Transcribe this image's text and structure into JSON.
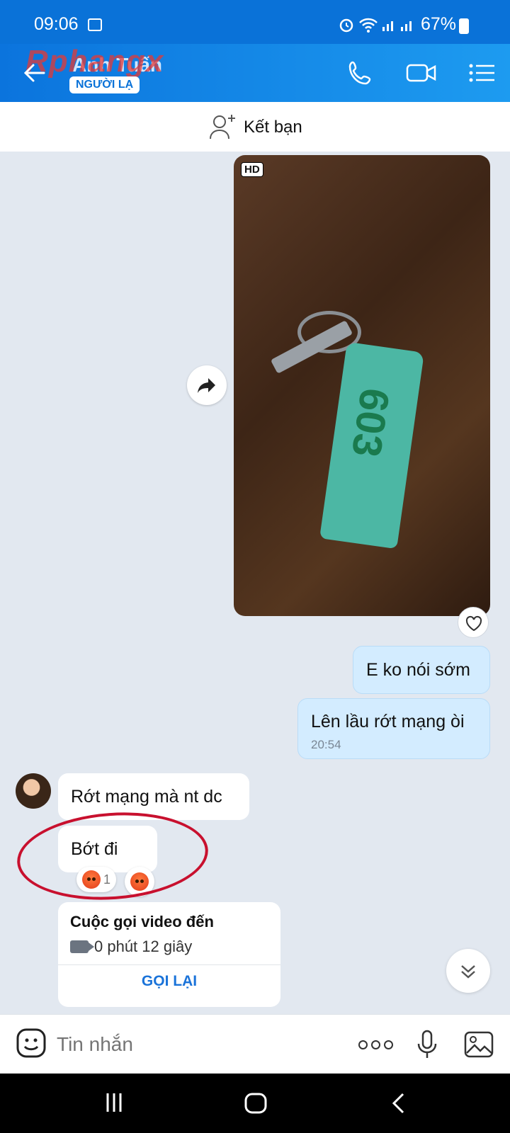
{
  "status_bar": {
    "time": "09:06",
    "battery": "67%"
  },
  "header": {
    "contact_name": "Anh Tuấn",
    "stranger_badge": "NGƯỜI LẠ",
    "watermark": "Rphangx"
  },
  "add_friend": {
    "label": "Kết bạn"
  },
  "photo_message": {
    "hd_badge": "HD",
    "key_tag_number": "603"
  },
  "messages": [
    {
      "text": "E ko nói sớm"
    },
    {
      "text": "Lên lầu rớt mạng òi",
      "time": "20:54"
    },
    {
      "text": "Rớt mạng mà nt dc"
    },
    {
      "text": "Bớt đi",
      "reaction_count": "1"
    }
  ],
  "call_card": {
    "title": "Cuộc gọi video đến",
    "duration": "0 phút 12 giây",
    "callback_label": "GỌI LẠI"
  },
  "composer": {
    "placeholder": "Tin nhắn"
  },
  "colors": {
    "header_blue": "#0b74dd",
    "outgoing_bubble": "#d3ecff",
    "annotation_red": "#c8102e"
  }
}
